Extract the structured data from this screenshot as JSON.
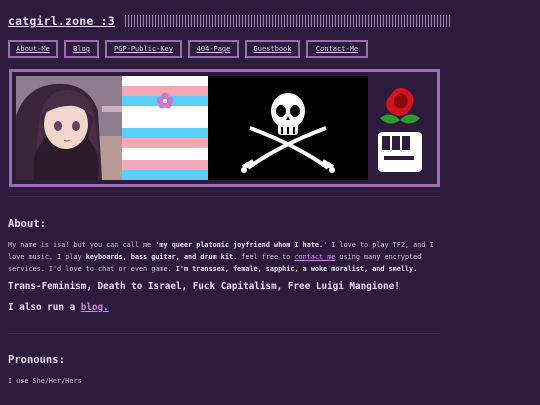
{
  "header": {
    "title": "catgirl.zone :3"
  },
  "nav": [
    {
      "label": "About-Me"
    },
    {
      "label": "Blog"
    },
    {
      "label": "PGP-Public-Key"
    },
    {
      "label": "404-Page"
    },
    {
      "label": "Guestbook"
    },
    {
      "label": "Contact-Me"
    }
  ],
  "colors": {
    "background": "#2d1b3d",
    "accent": "#9a6db3",
    "link": "#c58ae6",
    "trans_blue": "#5bcefa",
    "trans_pink": "#f5a9b8"
  },
  "banner": {
    "icons": [
      "anime-girl-avatar",
      "flower-icon",
      "jolly-roger-skull-icon",
      "rose-fist-icon"
    ]
  },
  "about": {
    "heading": "About:",
    "p1": "My name is isa! but you can call me '",
    "p1_bold1": "my queer platonic joyfriend whom I hate.",
    "p1_b": "' I love to play TF2, and I love music. I play ",
    "p1_bold2": "keyboards, bass guitar, and drum kit",
    "p1_c": ". feel free to ",
    "p1_link": "contact me",
    "p1_d": " using many encrypted services. I'd love to chat or even game. ",
    "p1_bold3": "I'm transsex, female, sapphic, a woke moralist, and smelly."
  },
  "slogan": "Trans-Feminism, Death to Israel, Fuck Capitalism, Free Luigi Mangione!",
  "blog": {
    "prefix": "I also run a ",
    "link": "blog."
  },
  "pronouns": {
    "heading": "Pronouns:",
    "text": "I use She/Her/Hers"
  }
}
